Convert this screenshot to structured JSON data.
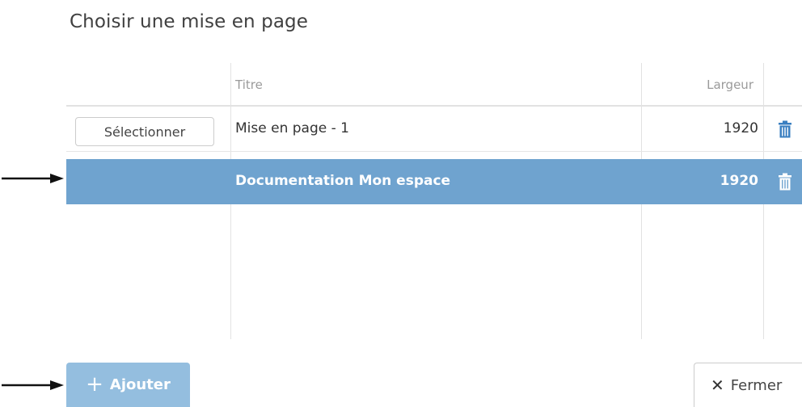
{
  "dialog": {
    "title": "Choisir une mise en page"
  },
  "table": {
    "columns": [
      "",
      "Titre",
      "Largeur",
      ""
    ],
    "rows": [
      {
        "action_label": "Sélectionner",
        "title": "Mise en page - 1",
        "width": "1920",
        "selected": false,
        "delete_icon": "trash-icon"
      },
      {
        "action_label": "",
        "title": "Documentation Mon espace",
        "width": "1920",
        "selected": true,
        "delete_icon": "trash-icon"
      }
    ]
  },
  "footer": {
    "add_label": "Ajouter",
    "add_icon": "plus-icon",
    "close_label": "Fermer",
    "close_icon": "close-icon"
  },
  "colors": {
    "selected_row": "#6fa3cf",
    "add_button": "#94bedf",
    "trash_icon": "#3a7fc1",
    "grid_line": "#e2e2e2"
  },
  "annotations": {
    "arrow_icon": "right-arrow-icon"
  }
}
